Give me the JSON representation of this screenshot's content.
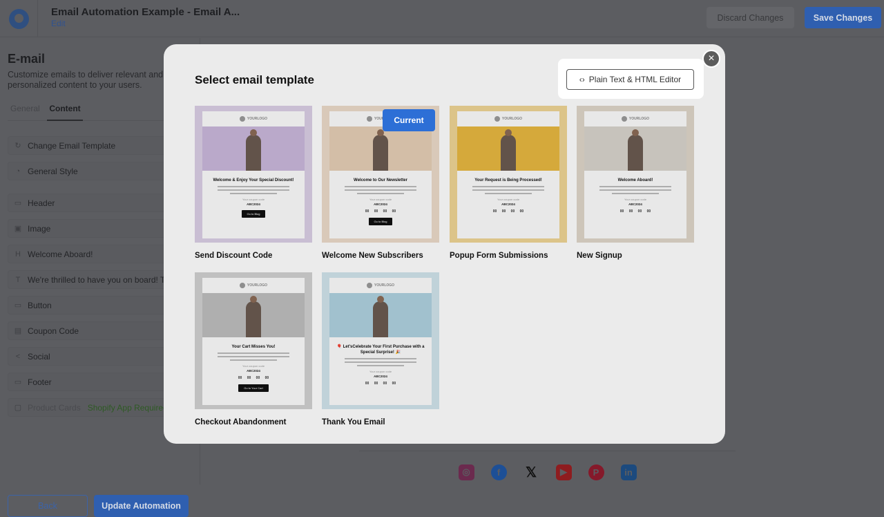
{
  "header": {
    "title": "Email Automation Example - Email A...",
    "edit_label": "Edit",
    "discard_label": "Discard Changes",
    "save_label": "Save Changes"
  },
  "sidebar": {
    "title": "E-mail",
    "description": "Customize emails to deliver relevant and personalized content to your users.",
    "tabs": [
      "General",
      "Content"
    ],
    "active_tab": "Content",
    "items": [
      {
        "icon": "refresh-icon",
        "label": "Change Email Template"
      },
      {
        "icon": "palette-icon",
        "label": "General Style"
      },
      {
        "icon": "header-icon",
        "label": "Header"
      },
      {
        "icon": "image-icon",
        "label": "Image"
      },
      {
        "icon": "heading-icon",
        "label": "Welcome Aboard!"
      },
      {
        "icon": "text-icon",
        "label": "We're thrilled to have you on board! Th"
      },
      {
        "icon": "button-icon",
        "label": "Button"
      },
      {
        "icon": "coupon-icon",
        "label": "Coupon Code"
      },
      {
        "icon": "share-icon",
        "label": "Social"
      },
      {
        "icon": "footer-icon",
        "label": "Footer"
      },
      {
        "icon": "bag-icon",
        "label": "Product Cards",
        "badge": "Shopify App Required"
      }
    ],
    "back_label": "Back",
    "update_label": "Update Automation"
  },
  "social_icons": [
    "instagram",
    "facebook",
    "x",
    "youtube",
    "pinterest",
    "linkedin"
  ],
  "modal": {
    "title": "Select email template",
    "editor_button": "Plain Text & HTML Editor",
    "current_badge": "Current",
    "templates": [
      {
        "name": "Send Discount Code",
        "heading": "Welcome & Enjoy Your Special Discount!",
        "code_label": "Your coupon code",
        "code": "ABC2024",
        "button": "Go to Blog",
        "timer": "",
        "frame": "#d9cde3",
        "image": "#c9b6da"
      },
      {
        "name": "Welcome New Subscribers",
        "heading": "Welcome to Our Newsletter",
        "code_label": "Your coupon code",
        "code": "ABC2024",
        "button": "Go to Blog",
        "timer": "00 00 00 00",
        "frame": "#ead9c8",
        "image": "#e4cdb4",
        "current": true
      },
      {
        "name": "Popup Form Submissions",
        "heading": "Your Request is Being Processed!",
        "code_label": "Your coupon code",
        "code": "ABC2024",
        "button": "",
        "timer": "00 00 00 00",
        "frame": "#edd394",
        "image": "#e6b640"
      },
      {
        "name": "New Signup",
        "heading": "Welcome Aboard!",
        "code_label": "Your coupon code",
        "code": "ABC2024",
        "button": "",
        "timer": "00 00 00 00",
        "frame": "#ddd4c8",
        "image": "#d7d2cb"
      },
      {
        "name": "Checkout Abandonment",
        "heading": "Your Cart Misses You!",
        "code_label": "Your coupon code",
        "code": "ABC2024",
        "button": "Go to Your Cart",
        "timer": "00 00 00 00",
        "frame": "#cfcfcf",
        "image": "#bdbdbd"
      },
      {
        "name": "Thank You Email",
        "heading": "🎈 Let'sCelebrate Your First Purchase with a Special Surprise! 🎉",
        "code_label": "Your coupon code",
        "code": "ABC2024",
        "button": "",
        "timer": "00 00 00 00",
        "frame": "#cfe2ea",
        "image": "#aed0de"
      }
    ]
  },
  "colors": {
    "accent": "#2d6fd6",
    "shopify_badge": "#3a8a2a"
  }
}
